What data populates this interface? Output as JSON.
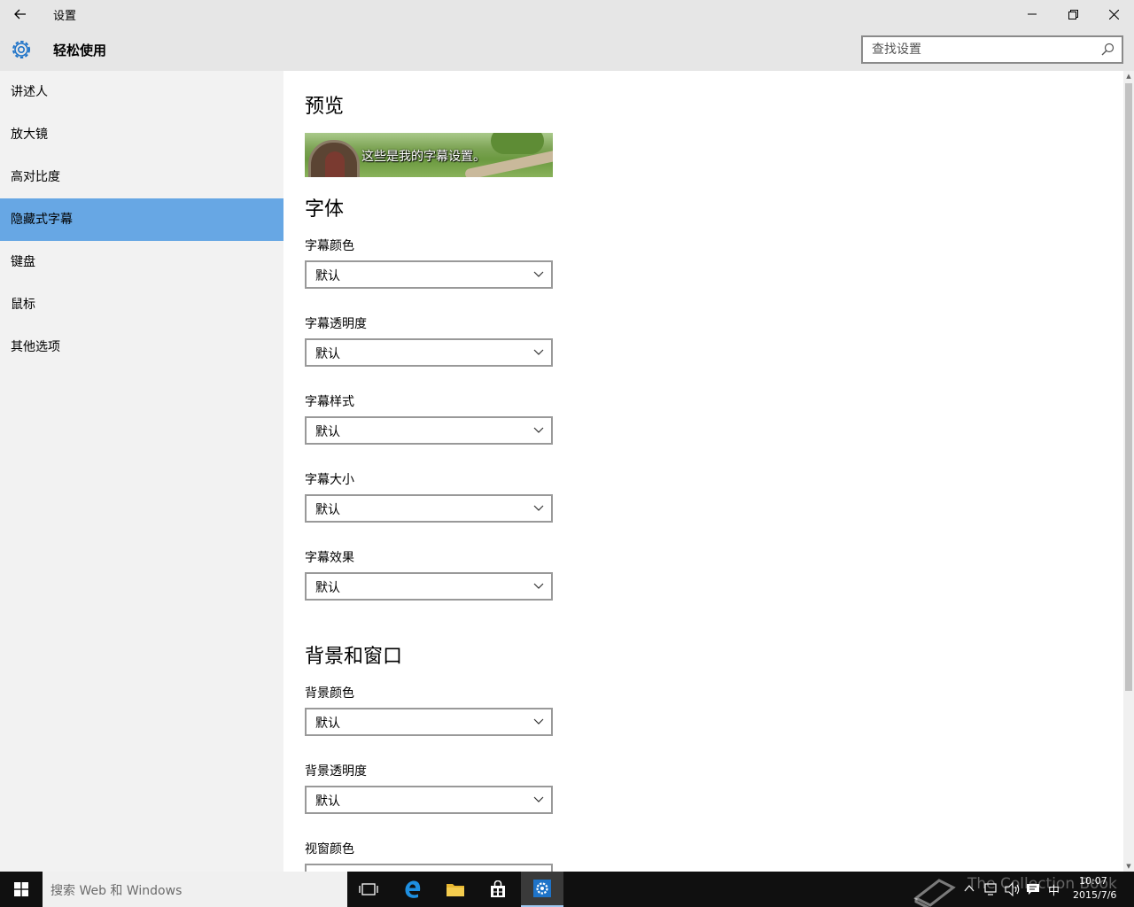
{
  "window": {
    "title": "设置",
    "back_icon": "arrow-left-icon",
    "minimize_icon": "minimize-icon",
    "maximize_icon": "restore-icon",
    "close_icon": "close-icon"
  },
  "header": {
    "section_title": "轻松使用",
    "gear_icon": "gear-icon",
    "accent_color": "#1e73c8",
    "search": {
      "placeholder": "查找设置",
      "value": ""
    }
  },
  "sidebar": {
    "active_color": "#67a7e4",
    "items": [
      {
        "label": "讲述人"
      },
      {
        "label": "放大镜"
      },
      {
        "label": "高对比度"
      },
      {
        "label": "隐藏式字幕",
        "active": true
      },
      {
        "label": "键盘"
      },
      {
        "label": "鼠标"
      },
      {
        "label": "其他选项"
      }
    ]
  },
  "main": {
    "preview": {
      "heading": "预览",
      "sample_text": "这些是我的字幕设置。"
    },
    "font": {
      "heading": "字体",
      "settings": [
        {
          "label": "字幕颜色",
          "value": "默认"
        },
        {
          "label": "字幕透明度",
          "value": "默认"
        },
        {
          "label": "字幕样式",
          "value": "默认"
        },
        {
          "label": "字幕大小",
          "value": "默认"
        },
        {
          "label": "字幕效果",
          "value": "默认"
        }
      ]
    },
    "background": {
      "heading": "背景和窗口",
      "settings": [
        {
          "label": "背景颜色",
          "value": "默认"
        },
        {
          "label": "背景透明度",
          "value": "默认"
        },
        {
          "label": "视窗颜色",
          "value": ""
        }
      ]
    }
  },
  "taskbar": {
    "search_placeholder": "搜索 Web 和 Windows",
    "ime": "中",
    "time": "10:07",
    "date": "2015/7/6",
    "watermark": "The Collection Book"
  }
}
